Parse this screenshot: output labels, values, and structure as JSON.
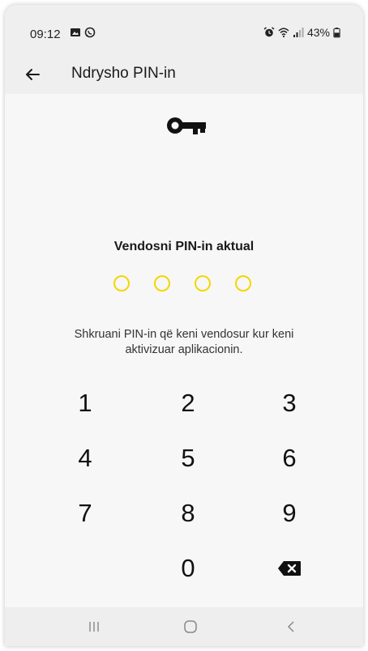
{
  "status_bar": {
    "time": "09:12",
    "battery": "43%",
    "left_icons": [
      "image-icon",
      "whatsapp-icon"
    ],
    "right_icons": [
      "alarm-icon",
      "wifi-icon",
      "signal-icon",
      "battery-icon"
    ]
  },
  "app_bar": {
    "back_icon": "arrow-left-icon",
    "title": "Ndrysho PIN-in"
  },
  "content": {
    "icon": "key-icon",
    "heading": "Vendosni PIN-in aktual",
    "pin_length": 4,
    "pin_filled": 0,
    "hint": "Shkruani PIN-in që keni vendosur kur keni aktivizuar aplikacionin."
  },
  "keypad": {
    "keys": [
      "1",
      "2",
      "3",
      "4",
      "5",
      "6",
      "7",
      "8",
      "9",
      "0"
    ],
    "delete_icon": "backspace-icon"
  },
  "nav_bar": {
    "icons": [
      "recents-icon",
      "home-icon",
      "back-icon"
    ]
  },
  "colors": {
    "accent": "#f2d700",
    "background": "#f7f7f7",
    "text": "#1a1a1a"
  }
}
